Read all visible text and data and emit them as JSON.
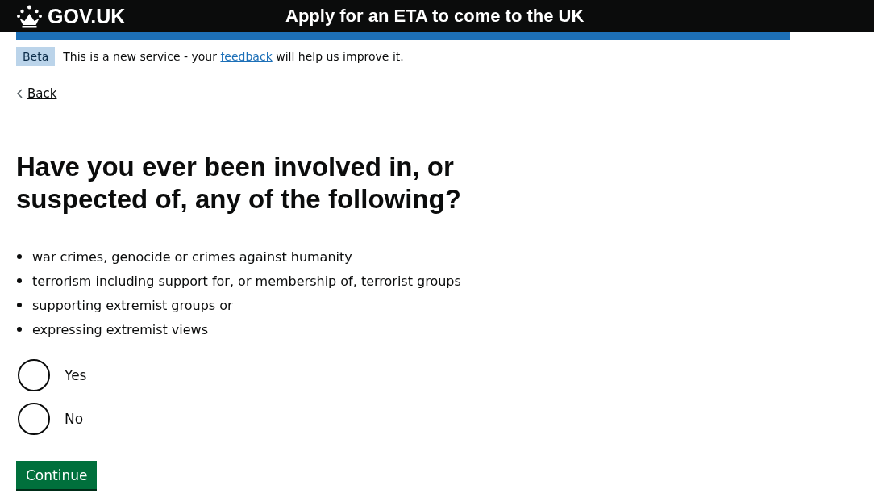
{
  "header": {
    "logo": "GOV.UK",
    "service_name": "Apply for an ETA to come to the UK"
  },
  "phase_banner": {
    "tag": "Beta",
    "text_before": "This is a new service - your ",
    "link": "feedback",
    "text_after": " will help us improve it."
  },
  "back_link": "Back",
  "question": "Have you ever been involved in, or suspected of, any of the following?",
  "items": [
    "war crimes, genocide or crimes against humanity",
    "terrorism including support for, or membership of, terrorist groups",
    "supporting extremist groups or",
    "expressing extremist views"
  ],
  "options": [
    {
      "label": "Yes",
      "selected": false
    },
    {
      "label": "No",
      "selected": false
    }
  ],
  "button": "Continue"
}
